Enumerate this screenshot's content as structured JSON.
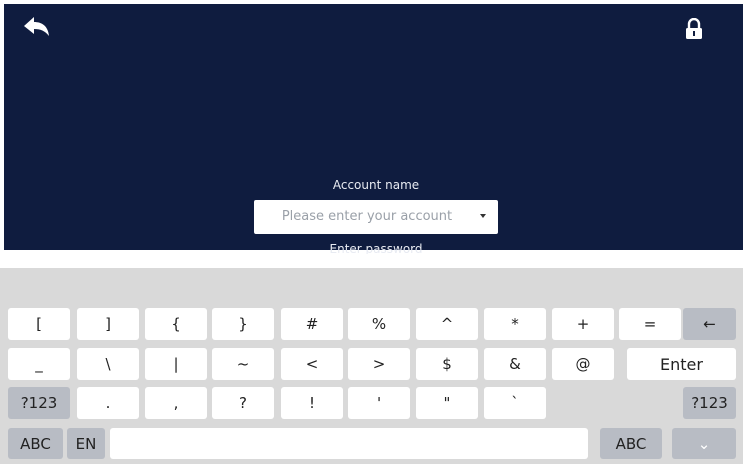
{
  "header": {
    "back_icon": "back-arrow-icon",
    "lock_icon": "lock-icon"
  },
  "form": {
    "account_label": "Account name",
    "account_placeholder": "Please enter your account",
    "password_label": "Enter password"
  },
  "keyboard": {
    "row1": [
      "[",
      "]",
      "{",
      "}",
      "#",
      "%",
      "^",
      "*",
      "+",
      "="
    ],
    "backspace_icon": "backspace-arrow-icon",
    "backspace_glyph": "←",
    "row2": [
      "_",
      "\\",
      "|",
      "~",
      "<",
      ">",
      "$",
      "&",
      "@"
    ],
    "enter_label": "Enter",
    "row3_left": "?123",
    "row3": [
      ".",
      ",",
      "?",
      "!",
      "'",
      "\"",
      "`"
    ],
    "row3_right": "?123",
    "abc_left": "ABC",
    "lang": "EN",
    "abc_right": "ABC",
    "collapse_icon": "chevron-down-icon",
    "collapse_glyph": "⌄"
  }
}
